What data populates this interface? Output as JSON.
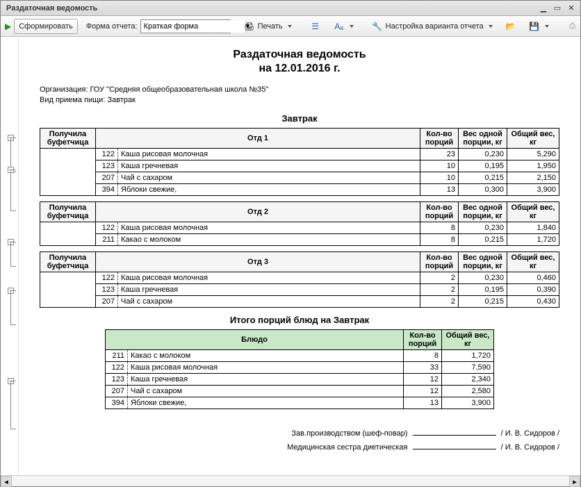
{
  "window": {
    "title": "Раздаточная ведомость"
  },
  "toolbar": {
    "form_button": "Сформировать",
    "form_label": "Форма отчета:",
    "combo_value": "Краткая форма",
    "print": "Печать",
    "settings": "Настройка варианта отчета"
  },
  "doc": {
    "title": "Раздаточная ведомость",
    "date_line": "на 12.01.2016 г.",
    "org_label": "Организация:",
    "org_value": "ГОУ \"Средняя общеобразовательная школа №35\"",
    "meal_label": "Вид приема пищи:",
    "meal_value": "Завтрак",
    "section_meal": "Завтрак",
    "totals_title": "Итого порций блюд на Завтрак"
  },
  "headers": {
    "buf": "Получила буфетчица",
    "qty": "Кол-во порций",
    "w1": "Вес одной порции, кг",
    "w2": "Общий вес, кг",
    "dish": "Блюдо"
  },
  "depts": [
    {
      "name": "Отд 1",
      "rows": [
        {
          "code": "122",
          "name": "Каша рисовая молочная",
          "qty": "23",
          "w1": "0,230",
          "w2": "5,290"
        },
        {
          "code": "123",
          "name": "Каша гречневая",
          "qty": "10",
          "w1": "0,195",
          "w2": "1,950"
        },
        {
          "code": "207",
          "name": "Чай с сахаром",
          "qty": "10",
          "w1": "0,215",
          "w2": "2,150"
        },
        {
          "code": "394",
          "name": "Яблоки свежие,",
          "qty": "13",
          "w1": "0,300",
          "w2": "3,900"
        }
      ]
    },
    {
      "name": "Отд 2",
      "rows": [
        {
          "code": "122",
          "name": "Каша рисовая молочная",
          "qty": "8",
          "w1": "0,230",
          "w2": "1,840"
        },
        {
          "code": "211",
          "name": "Какао с молоком",
          "qty": "8",
          "w1": "0,215",
          "w2": "1,720"
        }
      ]
    },
    {
      "name": "Отд 3",
      "rows": [
        {
          "code": "122",
          "name": "Каша рисовая молочная",
          "qty": "2",
          "w1": "0,230",
          "w2": "0,460"
        },
        {
          "code": "123",
          "name": "Каша гречневая",
          "qty": "2",
          "w1": "0,195",
          "w2": "0,390"
        },
        {
          "code": "207",
          "name": "Чай с сахаром",
          "qty": "2",
          "w1": "0,215",
          "w2": "0,430"
        }
      ]
    }
  ],
  "totals": [
    {
      "code": "211",
      "name": "Какао с молоком",
      "qty": "8",
      "w2": "1,720"
    },
    {
      "code": "122",
      "name": "Каша рисовая молочная",
      "qty": "33",
      "w2": "7,590"
    },
    {
      "code": "123",
      "name": "Каша гречневая",
      "qty": "12",
      "w2": "2,340"
    },
    {
      "code": "207",
      "name": "Чай с сахаром",
      "qty": "12",
      "w2": "2,580"
    },
    {
      "code": "394",
      "name": "Яблоки свежие,",
      "qty": "13",
      "w2": "3,900"
    }
  ],
  "sign": {
    "chef_label": "Зав.производством (шеф-повар)",
    "chef_name": "/ И. В. Сидоров /",
    "nurse_label": "Медицинская сестра диетическая",
    "nurse_name": "/ И. В. Сидоров /"
  }
}
